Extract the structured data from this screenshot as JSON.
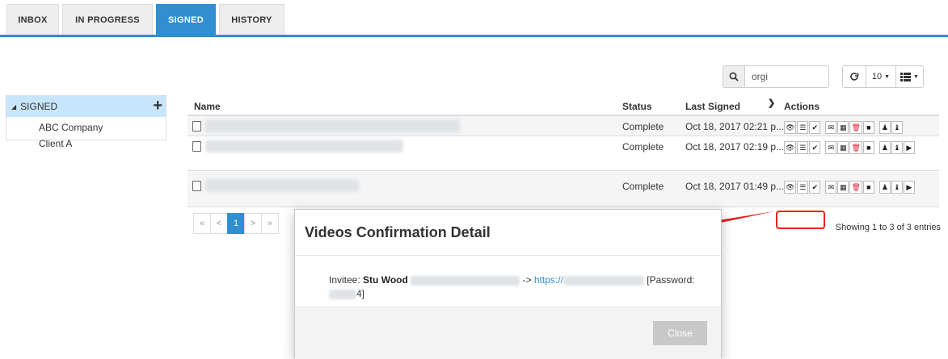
{
  "tabs": [
    {
      "label": "INBOX",
      "active": false
    },
    {
      "label": "IN PROGRESS",
      "active": false
    },
    {
      "label": "SIGNED",
      "active": true
    },
    {
      "label": "HISTORY",
      "active": false
    }
  ],
  "toolbar": {
    "search_value": "orgi",
    "page_size": "10",
    "search_icon": "search-icon",
    "refresh_icon": "refresh-icon",
    "columns_icon": "list-view-icon"
  },
  "tree": {
    "root_label": "SIGNED",
    "children": [
      "ABC Company",
      "Client A"
    ]
  },
  "table": {
    "headers": {
      "name": "Name",
      "status": "Status",
      "last_signed": "Last Signed",
      "actions": "Actions"
    },
    "rows": [
      {
        "status": "Complete",
        "last_signed": "Oct 18, 2017 02:21 p...."
      },
      {
        "status": "Complete",
        "last_signed": "Oct 18, 2017 02:19 p...."
      },
      {
        "status": "Complete",
        "last_signed": "Oct 18, 2017 01:49 p...."
      }
    ]
  },
  "pagination": {
    "first": "«",
    "prev": "<",
    "current": "1",
    "next": ">",
    "last": "»",
    "summary": "Showing 1 to 3 of 3 entries"
  },
  "modal": {
    "title": "Videos Confirmation Detail",
    "invitee_label": "Invitee:",
    "invitee_name": "Stu Wood",
    "arrow_text": "->",
    "link_prefix": "https://",
    "password_label": "[Password:",
    "password_suffix": "4]",
    "close_label": "Close"
  },
  "colors": {
    "accent": "#2f8fd0",
    "highlight": "#e21111",
    "tree_header": "#c8e6fb"
  }
}
